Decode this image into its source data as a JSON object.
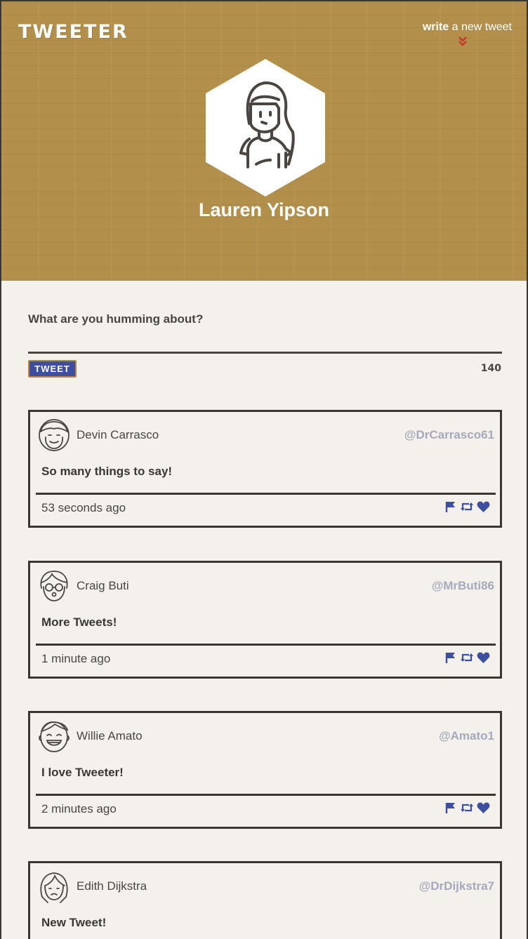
{
  "header": {
    "brand": "TWEETER",
    "write_bold": "write",
    "write_rest": " a new tweet",
    "profile_name": "Lauren Yipson"
  },
  "compose": {
    "prompt": "What are you humming about?",
    "button_label": "TWEET",
    "counter": "140"
  },
  "colors": {
    "header_bg": "#b38f4c",
    "accent_blue": "#3d4f9e",
    "handle_grey": "#a6a9bb",
    "arrow_red": "#c0392b"
  },
  "tweets": [
    {
      "name": "Devin Carrasco",
      "handle": "@DrCarrasco61",
      "text": "So many things to say!",
      "time": "53 seconds ago",
      "avatar": "man-avatar-icon"
    },
    {
      "name": "Craig Buti",
      "handle": "@MrButi86",
      "text": "More Tweets!",
      "time": "1 minute ago",
      "avatar": "glasses-avatar-icon"
    },
    {
      "name": "Willie Amato",
      "handle": "@Amato1",
      "text": "I love Tweeter!",
      "time": "2 minutes ago",
      "avatar": "laughing-avatar-icon"
    },
    {
      "name": "Edith Dijkstra",
      "handle": "@DrDijkstra7",
      "text": "New Tweet!",
      "time": "",
      "avatar": "woman-avatar-icon"
    }
  ]
}
